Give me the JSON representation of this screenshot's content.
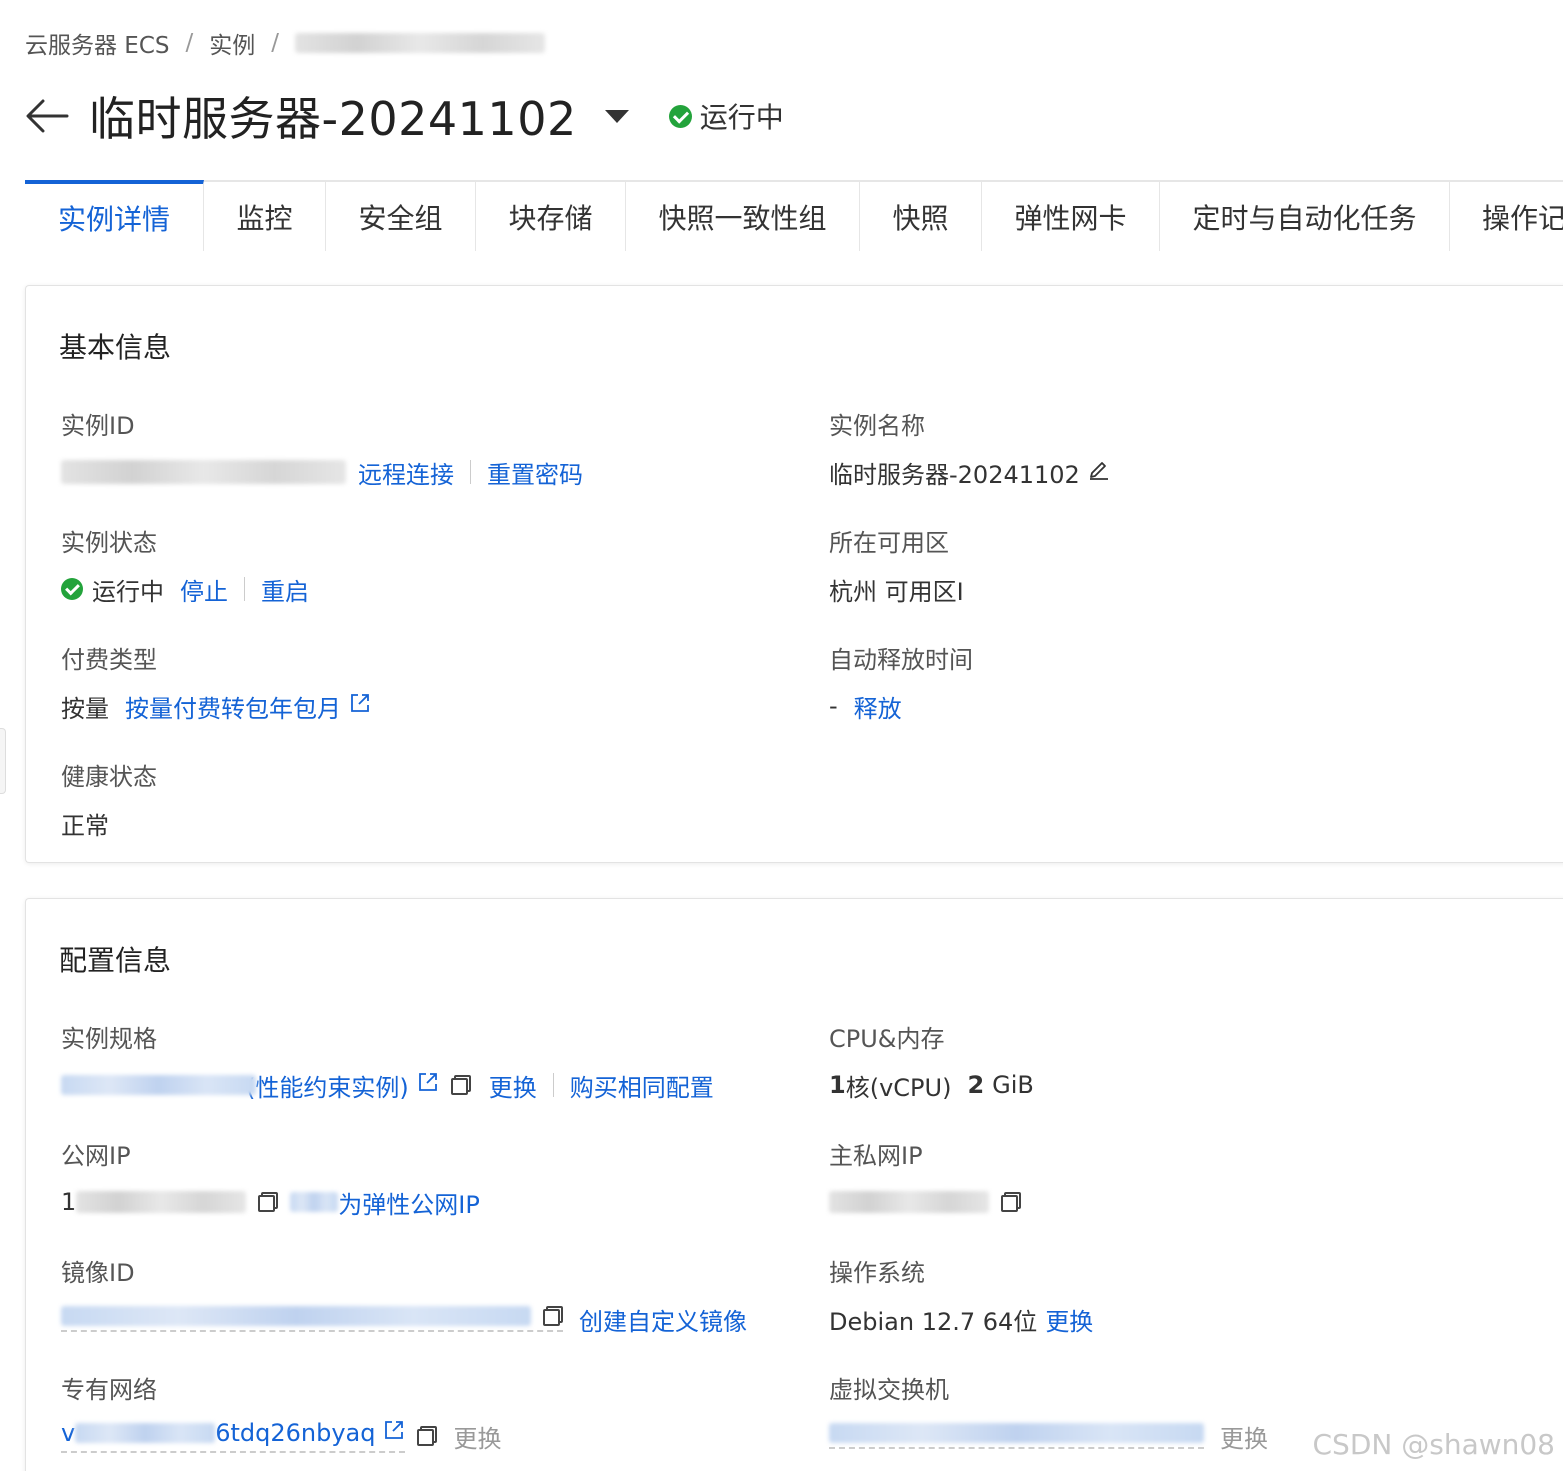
{
  "breadcrumb": {
    "items": [
      "云服务器 ECS",
      "实例"
    ],
    "separator": "/"
  },
  "header": {
    "title": "临时服务器-20241102",
    "status": "运行中"
  },
  "tabs": [
    "实例详情",
    "监控",
    "安全组",
    "块存储",
    "快照一致性组",
    "快照",
    "弹性网卡",
    "定时与自动化任务",
    "操作记"
  ],
  "basic_info": {
    "title": "基本信息",
    "instance_id": {
      "label": "实例ID",
      "remote_connect": "远程连接",
      "reset_password": "重置密码"
    },
    "instance_name": {
      "label": "实例名称",
      "value": "临时服务器-20241102"
    },
    "instance_status": {
      "label": "实例状态",
      "value": "运行中",
      "stop": "停止",
      "restart": "重启"
    },
    "zone": {
      "label": "所在可用区",
      "value": "杭州 可用区I"
    },
    "billing": {
      "label": "付费类型",
      "value": "按量",
      "convert": "按量付费转包年包月"
    },
    "auto_release": {
      "label": "自动释放时间",
      "value": "-",
      "release": "释放"
    },
    "health": {
      "label": "健康状态",
      "value": "正常"
    }
  },
  "config_info": {
    "title": "配置信息",
    "spec": {
      "label": "实例规格",
      "value_tail": "(性能约束实例)",
      "change": "更换",
      "buy_same": "购买相同配置"
    },
    "cpu_mem": {
      "label": "CPU&内存",
      "cpu_num": "1",
      "cpu_unit": "核(vCPU)",
      "mem_num": "2",
      "mem_unit": "GiB"
    },
    "public_ip": {
      "label": "公网IP",
      "prefix": "1",
      "convert_tail": "为弹性公网IP"
    },
    "private_ip": {
      "label": "主私网IP"
    },
    "image_id": {
      "label": "镜像ID",
      "create_image": "创建自定义镜像"
    },
    "os": {
      "label": "操作系统",
      "value": "Debian 12.7 64位",
      "change": "更换"
    },
    "vpc": {
      "label": "专有网络",
      "prefix": "v",
      "tail": "6tdq26nbyaq",
      "change": "更换"
    },
    "vswitch": {
      "label": "虚拟交换机",
      "change": "更换"
    }
  },
  "watermark": "CSDN @shawn08",
  "colors": {
    "link": "#1463d6",
    "success": "#23a33b",
    "text": "#333333",
    "muted": "#999999"
  }
}
